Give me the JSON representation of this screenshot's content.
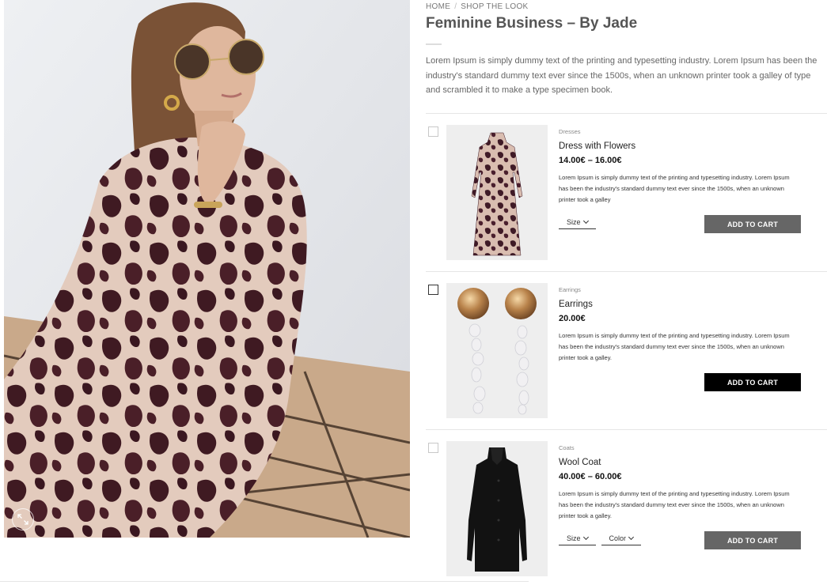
{
  "breadcrumb": {
    "home": "HOME",
    "separator": "/",
    "current": "SHOP THE LOOK"
  },
  "page": {
    "title": "Feminine Business – By Jade",
    "description": "Lorem Ipsum is simply dummy text of the printing and typesetting industry. Lorem Ipsum has been the industry's standard dummy text ever since the 1500s, when an unknown printer took a galley of type and scrambled it to make a type specimen book."
  },
  "hero": {
    "zoom_icon": "expand-icon"
  },
  "colors": {
    "button_gray": "#666666",
    "button_black": "#000000",
    "title": "#555555"
  },
  "products": [
    {
      "category": "Dresses",
      "name": "Dress with Flowers",
      "price": "14.00€ – 16.00€",
      "description": "Lorem Ipsum is simply dummy text of the printing and typesetting industry. Lorem Ipsum has been the industry's standard dummy text ever since the 1500s, when an unknown printer took a galley",
      "variants": [
        "Size"
      ],
      "button": "ADD TO CART"
    },
    {
      "category": "Earrings",
      "name": "Earrings",
      "price": "20.00€",
      "description": "Lorem Ipsum is simply dummy text of the printing and typesetting industry. Lorem Ipsum has been the industry's standard dummy text ever since the 1500s, when an unknown printer took a galley.",
      "variants": [],
      "button": "ADD TO CART"
    },
    {
      "category": "Coats",
      "name": "Wool Coat",
      "price": "40.00€ – 60.00€",
      "description": "Lorem Ipsum is simply dummy text of the printing and typesetting industry. Lorem Ipsum has been the industry's standard dummy text ever since the 1500s, when an unknown printer took a galley.",
      "variants": [
        "Size",
        "Color"
      ],
      "button": "ADD TO CART"
    }
  ]
}
